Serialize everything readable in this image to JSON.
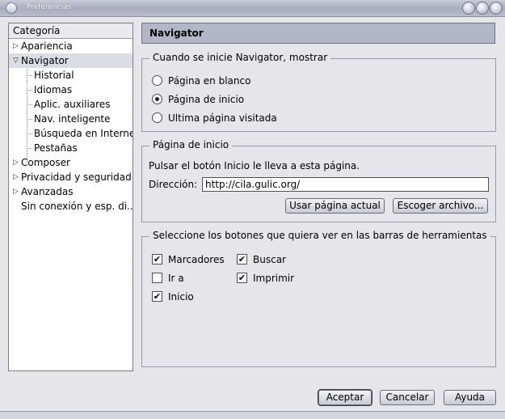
{
  "window": {
    "title": "Preferencias"
  },
  "tree": {
    "header": "Categoría",
    "items": [
      {
        "label": "Apariencia",
        "expanded": false
      },
      {
        "label": "Navigator",
        "expanded": true,
        "selected": true
      },
      {
        "label": "Historial",
        "child": true
      },
      {
        "label": "Idiomas",
        "child": true
      },
      {
        "label": "Aplic. auxiliares",
        "child": true
      },
      {
        "label": "Nav. inteligente",
        "child": true
      },
      {
        "label": "Búsqueda en Internet",
        "child": true
      },
      {
        "label": "Pestañas",
        "child": true
      },
      {
        "label": "Composer",
        "expanded": false
      },
      {
        "label": "Privacidad y seguridad",
        "expanded": false
      },
      {
        "label": "Avanzadas",
        "expanded": false
      },
      {
        "label": "Sin conexión y esp. di...",
        "leaf": true
      }
    ]
  },
  "panel": {
    "title": "Navigator",
    "startup": {
      "legend": "Cuando se inicie Navigator, mostrar",
      "options": [
        {
          "label": "Página en blanco",
          "selected": false
        },
        {
          "label": "Página de inicio",
          "selected": true
        },
        {
          "label": "Ultima página visitada",
          "selected": false
        }
      ]
    },
    "homepage": {
      "legend": "Página de inicio",
      "description": "Pulsar el botón Inicio le lleva a esta página.",
      "address_label": "Dirección:",
      "address_value": "http://cila.gulic.org/",
      "use_current_label": "Usar página actual",
      "choose_file_label": "Escoger archivo..."
    },
    "toolbar_buttons": {
      "legend": "Seleccione los botones que quiera ver en las barras de herramientas",
      "items": [
        {
          "label": "Marcadores",
          "checked": true
        },
        {
          "label": "Buscar",
          "checked": true
        },
        {
          "label": "Ir a",
          "checked": false
        },
        {
          "label": "Imprimir",
          "checked": true
        },
        {
          "label": "Inicio",
          "checked": true
        }
      ]
    }
  },
  "footer": {
    "ok_label": "Aceptar",
    "cancel_label": "Cancelar",
    "help_label": "Ayuda"
  }
}
